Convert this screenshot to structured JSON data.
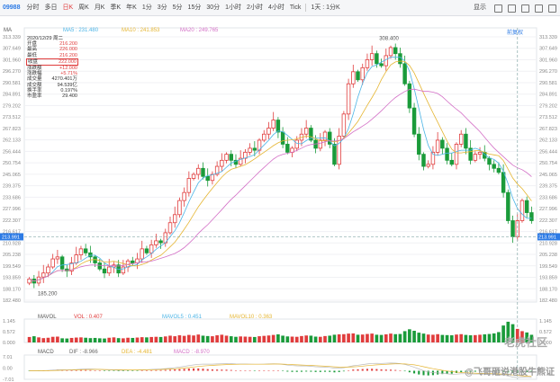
{
  "toolbar": {
    "code": "09988",
    "timeframes": [
      "分时",
      "多日",
      "日K",
      "周K",
      "月K",
      "季K",
      "年K",
      "1分",
      "3分",
      "5分",
      "15分",
      "30分",
      "1小时",
      "2小时",
      "4小时",
      "Tick"
    ],
    "active_index": 2,
    "sub_mode": "1天 : 1分K",
    "display_label": "显示"
  },
  "indicators": {
    "main_label": "MA",
    "ma5": "MA5 : 231.480",
    "ma10": "MA10 : 241.853",
    "ma20": "MA20 : 249.765",
    "flag": "前复权",
    "vol_label": "MAVOL",
    "vol": "VOL : 0.407",
    "mavol5": "MAVOL5 : 0.451",
    "mavol10": "MAVOL10 : 0.363",
    "macd_label": "MACD",
    "dif": "DIF : -8.966",
    "dea": "DEA : -4.481",
    "macd": "MACD : -8.970"
  },
  "info": {
    "date": "2020/12/29 周二",
    "rows": [
      {
        "k": "开盘",
        "v": "216.200",
        "c": "up"
      },
      {
        "k": "最高",
        "v": "226.000",
        "c": "up"
      },
      {
        "k": "最低",
        "v": "216.200",
        "c": "up"
      },
      {
        "k": "收盘",
        "v": "222.000",
        "c": "up",
        "hl": true
      },
      {
        "k": "涨跌额",
        "v": "+12.000",
        "c": "up"
      },
      {
        "k": "涨跌幅",
        "v": "+5.71%",
        "c": "up"
      },
      {
        "k": "成交量",
        "v": "4270.401万",
        "c": ""
      },
      {
        "k": "成交额",
        "v": "94.539亿",
        "c": ""
      },
      {
        "k": "换手率",
        "v": "0.197%",
        "c": ""
      },
      {
        "k": "市盈率",
        "v": "29.400",
        "c": ""
      }
    ]
  },
  "axis": {
    "price_ticks": [
      "313.339",
      "307.649",
      "301.960",
      "296.270",
      "290.581",
      "284.891",
      "279.202",
      "273.512",
      "267.823",
      "262.133",
      "256.444",
      "250.754",
      "245.065",
      "239.375",
      "233.686",
      "227.996",
      "222.307",
      "216.617",
      "210.928",
      "205.238",
      "199.549",
      "193.859",
      "188.170",
      "182.480"
    ],
    "crosshair_price": "213.991",
    "high_label": "308.400",
    "low_label": "185.200",
    "vol_ticks": [
      "1.145",
      "0.572",
      "0.000"
    ],
    "macd_ticks": [
      "7.01",
      "0.00",
      "-7.01"
    ]
  },
  "colors": {
    "up": "#e03c3c",
    "down": "#1a9b3a",
    "ma5": "#4bb4e6",
    "ma10": "#e5b531",
    "ma20": "#d36fc6",
    "dif": "#ccc",
    "dea": "#e5b531"
  },
  "watermark": {
    "line1": "老虎社区",
    "line2": "@飞哥砸说港股牛熊证"
  },
  "chart_data": {
    "type": "candlestick",
    "ylim": [
      182.48,
      313.339
    ],
    "close": [
      193,
      191,
      194,
      196,
      199,
      203,
      204,
      198,
      197,
      201,
      205,
      208,
      206,
      204,
      201,
      198,
      196,
      199,
      200,
      196,
      199,
      202,
      201,
      203,
      208,
      206,
      210,
      212,
      211,
      216,
      221,
      225,
      232,
      236,
      243,
      245,
      248,
      244,
      242,
      245,
      249,
      252,
      255,
      252,
      250,
      253,
      256,
      258,
      257,
      262,
      265,
      268,
      272,
      266,
      260,
      256,
      258,
      262,
      265,
      268,
      262,
      258,
      262,
      266,
      260,
      250,
      264,
      275,
      290,
      296,
      292,
      298,
      302,
      305,
      300,
      299,
      304,
      308,
      305,
      300,
      290,
      278,
      265,
      255,
      249,
      250,
      256,
      262,
      258,
      252,
      250,
      260,
      265,
      258,
      252,
      255,
      256,
      253,
      250,
      248,
      246,
      236,
      222,
      214,
      222,
      232,
      226,
      222
    ],
    "volume": [
      0.29,
      0.33,
      0.27,
      0.23,
      0.25,
      0.3,
      0.31,
      0.22,
      0.21,
      0.24,
      0.26,
      0.27,
      0.25,
      0.23,
      0.24,
      0.22,
      0.21,
      0.25,
      0.27,
      0.23,
      0.22,
      0.25,
      0.24,
      0.26,
      0.28,
      0.27,
      0.29,
      0.3,
      0.29,
      0.32,
      0.36,
      0.33,
      0.38,
      0.35,
      0.4,
      0.37,
      0.42,
      0.36,
      0.34,
      0.33,
      0.38,
      0.41,
      0.36,
      0.33,
      0.3,
      0.32,
      0.31,
      0.3,
      0.29,
      0.33,
      0.35,
      0.37,
      0.4,
      0.43,
      0.36,
      0.32,
      0.31,
      0.3,
      0.34,
      0.37,
      0.36,
      0.31,
      0.3,
      0.34,
      0.36,
      0.41,
      0.43,
      0.44,
      0.47,
      0.48,
      0.41,
      0.42,
      0.45,
      0.47,
      0.41,
      0.4,
      0.43,
      0.47,
      0.44,
      0.45,
      0.6,
      0.7,
      0.62,
      0.52,
      0.47,
      0.42,
      0.41,
      0.44,
      0.4,
      0.39,
      0.38,
      0.42,
      0.44,
      0.4,
      0.38,
      0.39,
      0.41,
      0.43,
      0.45,
      0.48,
      0.55,
      0.9,
      1.1,
      0.97,
      0.72,
      0.6,
      0.53,
      0.407
    ],
    "macd_ylim": [
      -7.01,
      7.01
    ]
  }
}
